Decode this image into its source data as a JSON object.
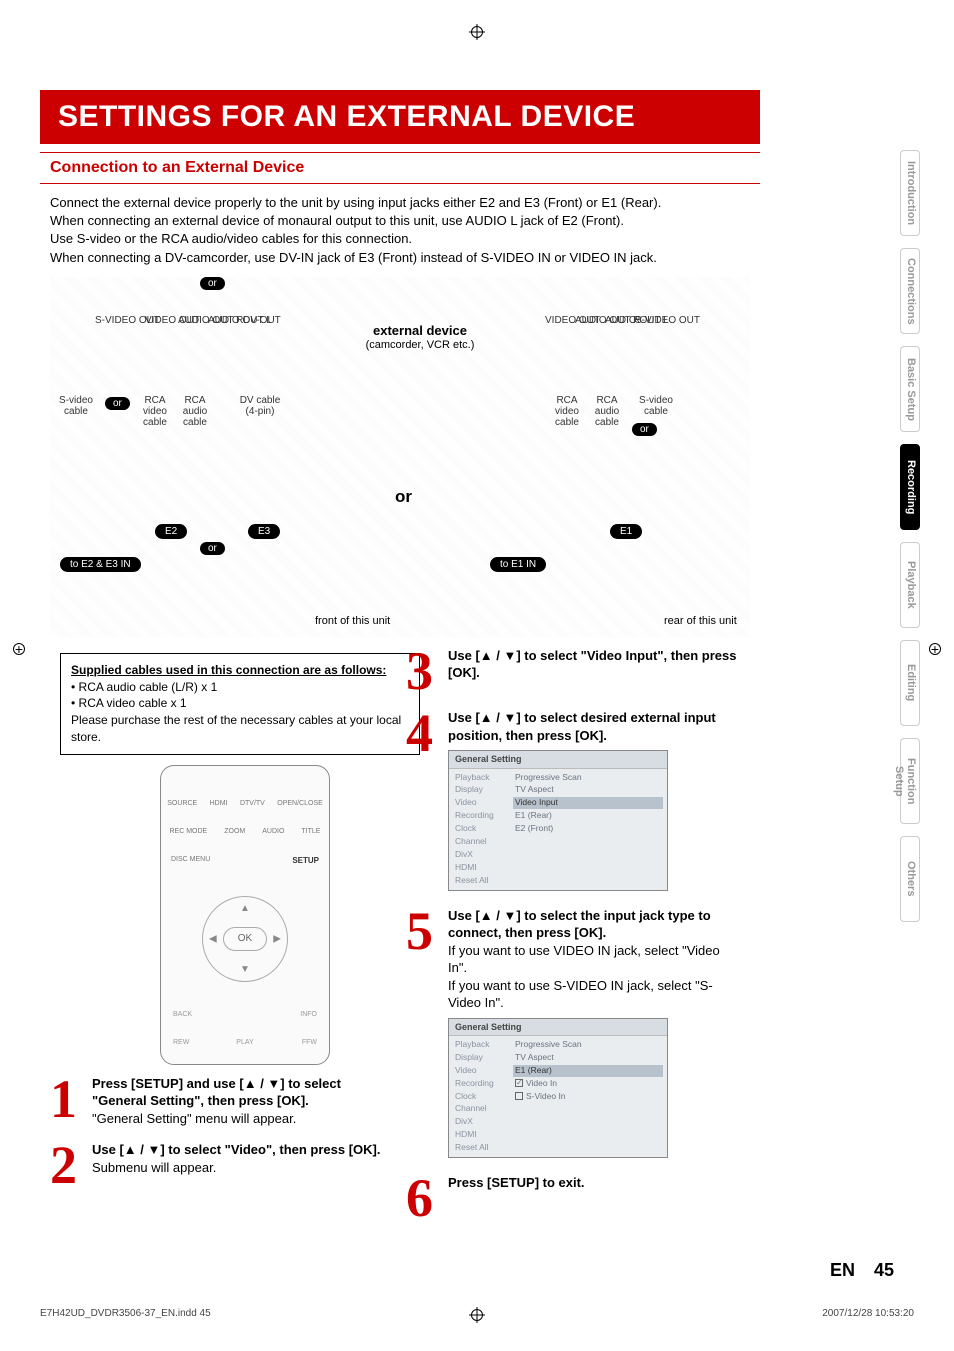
{
  "page": {
    "title": "SETTINGS FOR AN EXTERNAL DEVICE",
    "section_header": "Connection to an External Device",
    "intro_lines": [
      "Connect the external device properly to the unit by using input jacks either E2 and E3 (Front) or E1 (Rear).",
      "When connecting an external device of monaural output to this unit, use AUDIO L jack of E2 (Front).",
      "Use S-video or the RCA audio/video cables for this connection.",
      "When connecting a DV-camcorder, use DV-IN jack of E3 (Front) instead of S-VIDEO IN or VIDEO IN jack."
    ],
    "page_label_en": "EN",
    "page_number": "45",
    "footer_left": "E7H42UD_DVDR3506-37_EN.indd   45",
    "footer_right": "2007/12/28   10:53:20"
  },
  "tabs": {
    "items": [
      "Introduction",
      "Connections",
      "Basic Setup",
      "Recording",
      "Playback",
      "Editing",
      "Function Setup",
      "Others"
    ],
    "active_index": 3
  },
  "diagram": {
    "or": "or",
    "big_or": "or",
    "ext_device_title": "external device",
    "ext_device_sub": "(camcorder, VCR etc.)",
    "left_top_labels": [
      "S-VIDEO OUT",
      "VIDEO OUT",
      "AUDIO OUT R",
      "AUDIO OUT L",
      "DV-OUT"
    ],
    "right_top_labels": [
      "VIDEO OUT",
      "AUDIO OUT R",
      "AUDIO OUT L",
      "S-VIDEO OUT"
    ],
    "left_cables": [
      "S-video cable",
      "RCA video cable",
      "RCA audio cable",
      "DV cable (4-pin)"
    ],
    "right_cables": [
      "RCA video cable",
      "RCA audio cable",
      "S-video cable"
    ],
    "tag_e2": "E2",
    "tag_e3": "E3",
    "tag_e1": "E1",
    "to_e2e3": "to E2 & E3 IN",
    "to_e1": "to E1 IN",
    "front_label": "front of this unit",
    "rear_label": "rear of this unit"
  },
  "supply_box": {
    "header": "Supplied cables used in this connection are as follows:",
    "line1": "• RCA audio cable (L/R) x 1",
    "line2": "• RCA video cable x 1",
    "line3": "Please purchase the rest of the necessary cables at your local store."
  },
  "remote": {
    "row1": [
      "SOURCE",
      "HDMI",
      "DTV/TV",
      "OPEN/CLOSE"
    ],
    "row2": [
      "REC MODE",
      "ZOOM",
      "AUDIO",
      "TITLE"
    ],
    "row3_left": "DISC MENU",
    "row3_right": "SETUP",
    "ok": "OK",
    "bottom_left": "BACK",
    "bottom_right": "INFO",
    "bottom2_left": "REW",
    "bottom2_mid": "PLAY",
    "bottom2_right": "FFW"
  },
  "steps": {
    "s1": {
      "num": "1",
      "bold": "Press [SETUP] and use [▲ / ▼] to select \"General Setting\", then press [OK].",
      "rest": "\"General Setting\" menu will appear."
    },
    "s2": {
      "num": "2",
      "bold": "Use [▲ / ▼] to select \"Video\", then press [OK].",
      "rest": "Submenu will appear."
    },
    "s3": {
      "num": "3",
      "bold": "Use [▲ / ▼] to select \"Video Input\", then press [OK]."
    },
    "s4": {
      "num": "4",
      "bold": "Use [▲ / ▼] to select desired external input position, then press [OK]."
    },
    "s5": {
      "num": "5",
      "bold": "Use [▲ / ▼] to select the input jack type to connect, then press [OK].",
      "rest1": "If you want to use VIDEO IN jack, select \"Video In\".",
      "rest2": " If you want to use S-VIDEO IN jack, select \"S-Video In\"."
    },
    "s6": {
      "num": "6",
      "bold": "Press [SETUP] to exit."
    }
  },
  "menus": {
    "title": "General Setting",
    "left_items": [
      "Playback",
      "Display",
      "Video",
      "Recording",
      "Clock",
      "Channel",
      "DivX",
      "HDMI",
      "Reset All"
    ],
    "menu4_right": {
      "l1": "Progressive Scan",
      "l2": "TV Aspect",
      "highlight": "Video Input",
      "l3": "E1 (Rear)",
      "l4": "E2 (Front)"
    },
    "menu5_right": {
      "l1": "Progressive Scan",
      "l2": "TV Aspect",
      "highlight": "E1 (Rear)",
      "opt1": "Video In",
      "opt2": "S-Video In"
    }
  }
}
